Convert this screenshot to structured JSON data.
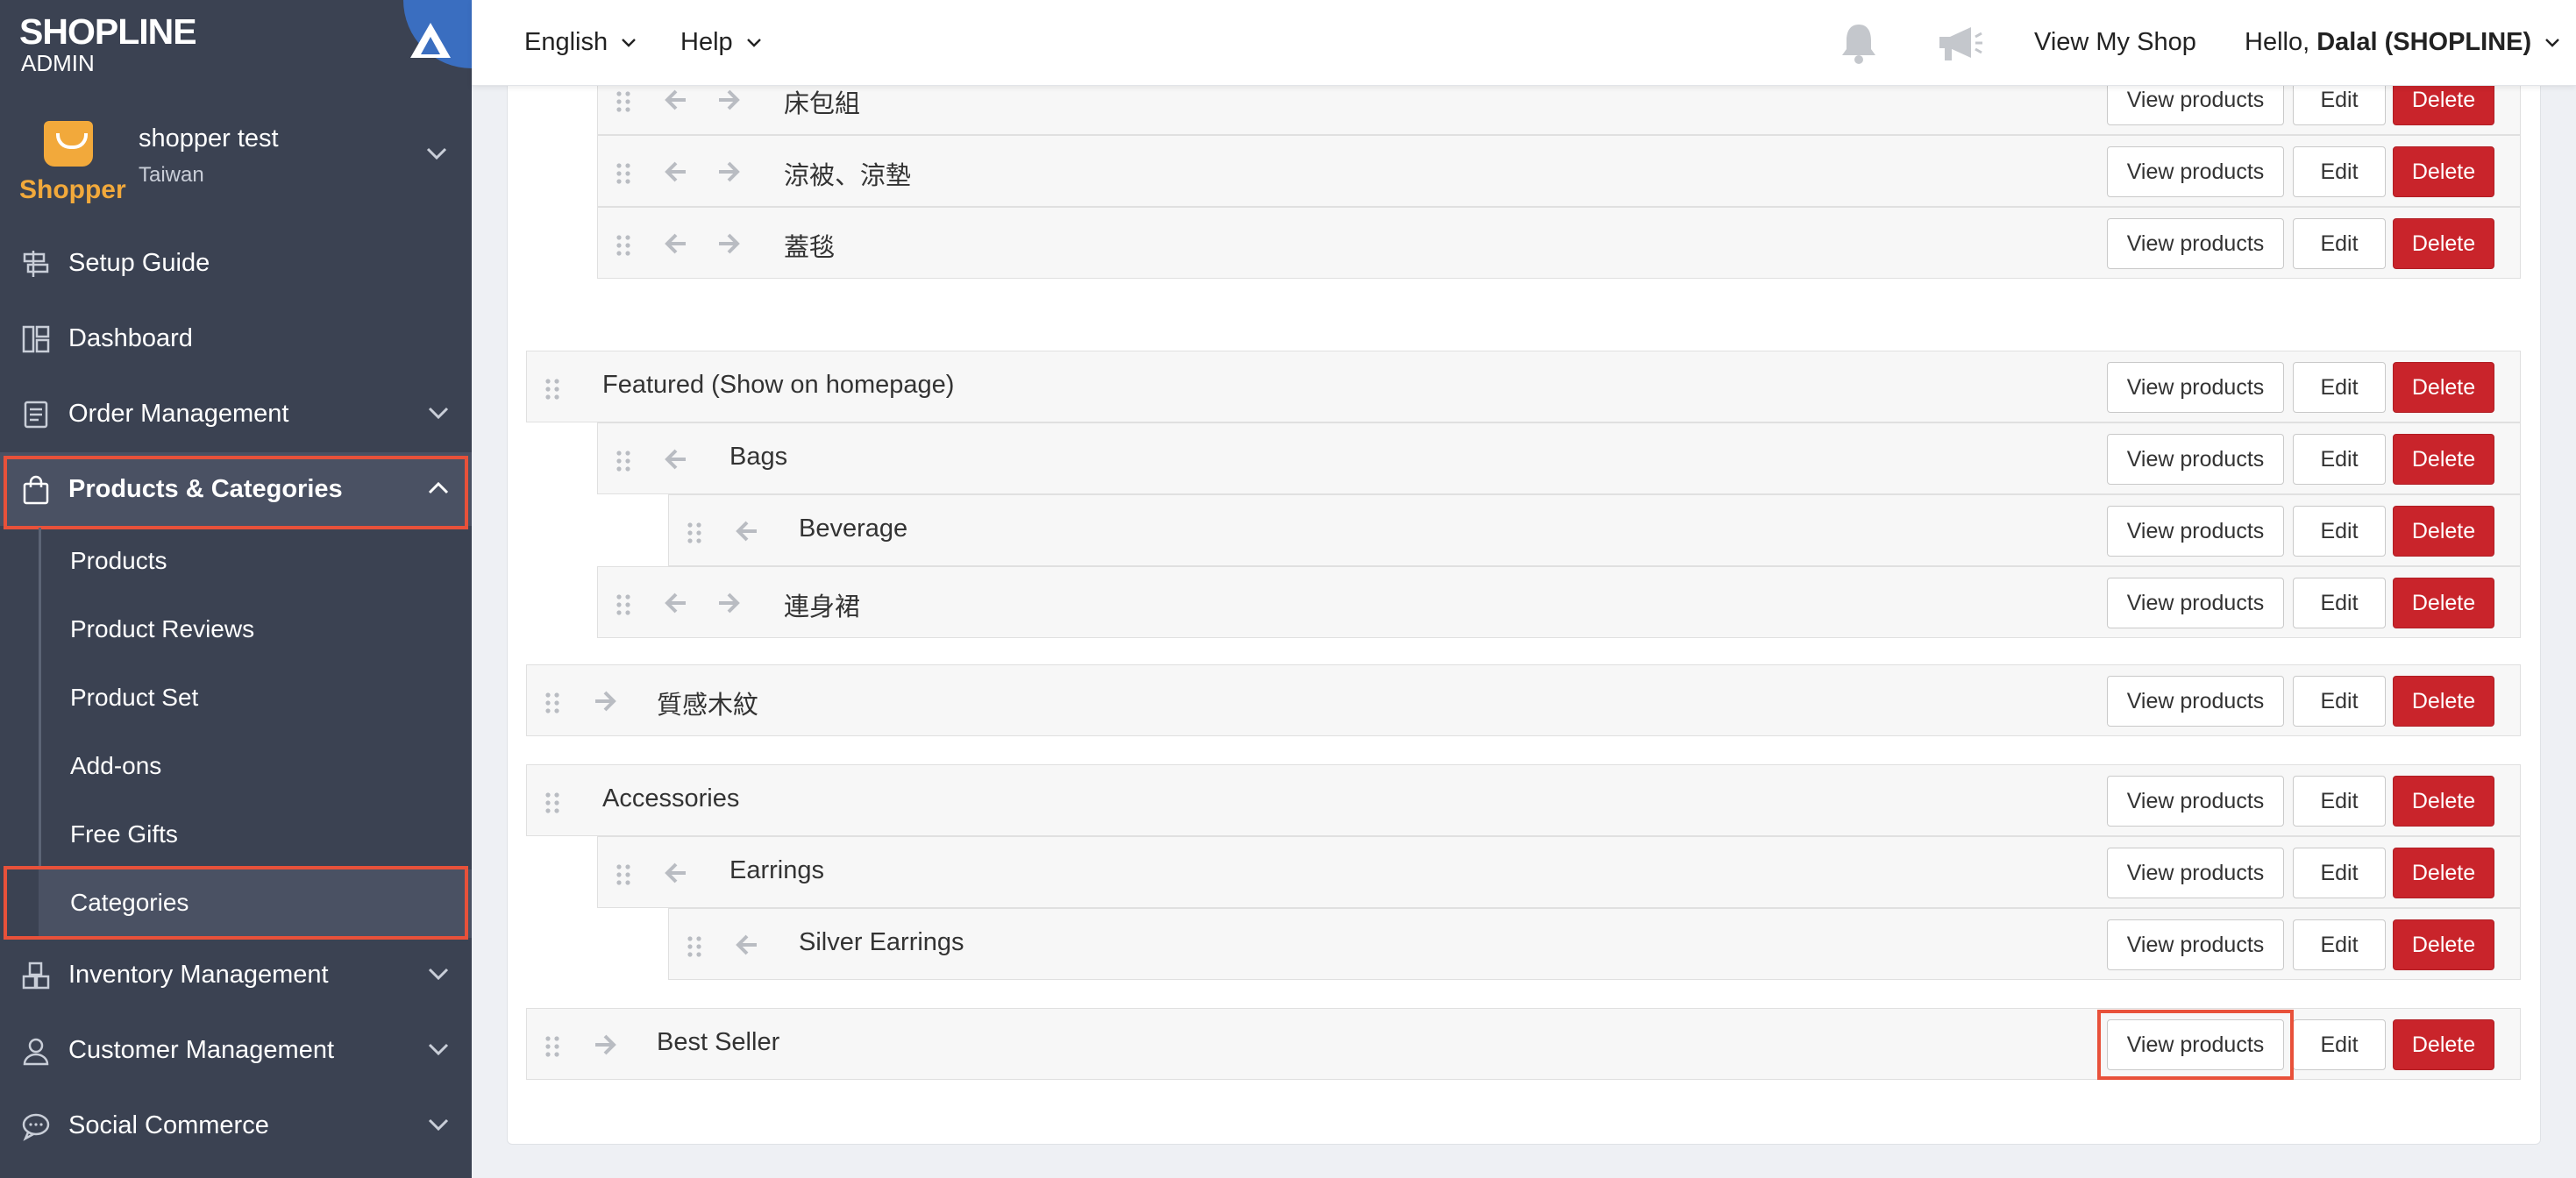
{
  "brand": {
    "name": "SHOPLINE",
    "sub": "ADMIN"
  },
  "shop": {
    "logo_word": "Shopper",
    "name": "shopper test",
    "region": "Taiwan"
  },
  "sidebar": {
    "items": [
      {
        "label": "Setup Guide",
        "icon": "signpost-icon"
      },
      {
        "label": "Dashboard",
        "icon": "dashboard-icon"
      },
      {
        "label": "Order Management",
        "icon": "clipboard-icon"
      },
      {
        "label": "Products & Categories",
        "icon": "shopping-bag-icon"
      },
      {
        "label": "Inventory Management",
        "icon": "boxes-icon"
      },
      {
        "label": "Customer Management",
        "icon": "user-icon"
      },
      {
        "label": "Social Commerce",
        "icon": "chat-bubble-icon"
      }
    ],
    "subitems": [
      "Products",
      "Product Reviews",
      "Product Set",
      "Add-ons",
      "Free Gifts",
      "Categories"
    ]
  },
  "topbar": {
    "language": "English",
    "help": "Help",
    "view_shop": "View My Shop",
    "greeting": "Hello,",
    "user": "Dalal (SHOPLINE)"
  },
  "buttons": {
    "view": "View products",
    "edit": "Edit",
    "delete": "Delete"
  },
  "categories": {
    "r1": "床包組",
    "r2": "涼被、涼墊",
    "r3": "蓋毯",
    "r4": "Featured (Show on homepage)",
    "r5": "Bags",
    "r6": "Beverage",
    "r7": "連身裙",
    "r8": "質感木紋",
    "r9": "Accessories",
    "r10": "Earrings",
    "r11": "Silver Earrings",
    "r12": "Best Seller"
  },
  "colors": {
    "sidebar": "#3b4252",
    "highlight": "#e8513a",
    "delete": "#c9242b",
    "brand_accent": "#3a6ec0",
    "shop_logo": "#f2a93b"
  }
}
